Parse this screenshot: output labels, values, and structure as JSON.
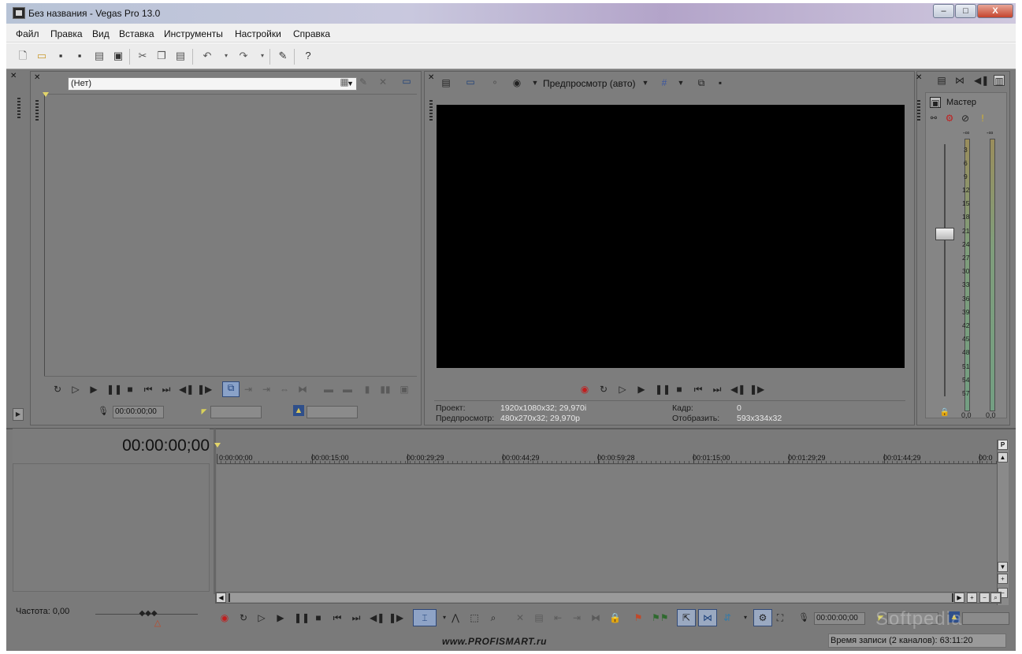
{
  "window": {
    "title": "Без названия - Vegas Pro 13.0",
    "minimize": "–",
    "maximize": "□",
    "close": "X"
  },
  "menu": [
    "Файл",
    "Правка",
    "Вид",
    "Вставка",
    "Инструменты",
    "Настройки",
    "Справка"
  ],
  "toolbar": {
    "icons": [
      "new-file-icon",
      "open-folder-icon",
      "save-icon",
      "save-as-icon",
      "render-icon",
      "properties-icon",
      "cut-icon",
      "copy-icon",
      "paste-icon",
      "undo-icon",
      "redo-icon",
      "edit-tool-icon",
      "help-icon"
    ]
  },
  "explorer": {
    "combo_value": "(Нет)"
  },
  "explorer_transport": {
    "timecode": "00:00:00;00"
  },
  "preview": {
    "mode_label": "Предпросмотр (авто)",
    "project_label": "Проект:",
    "project_value": "1920x1080x32; 29,970i",
    "preview_label": "Предпросмотр:",
    "preview_value": "480x270x32; 29,970p",
    "frame_label": "Кадр:",
    "frame_value": "0",
    "display_label": "Отобразить:",
    "display_value": "593x334x32"
  },
  "mixer": {
    "master_label": "Мастер",
    "meter_top": [
      "-∞",
      "-∞"
    ],
    "scale": [
      "3",
      "6",
      "9",
      "12",
      "15",
      "18",
      "21",
      "24",
      "27",
      "30",
      "33",
      "36",
      "39",
      "42",
      "45",
      "48",
      "51",
      "54",
      "57"
    ],
    "left_value": "0,0",
    "right_value": "0,0"
  },
  "timeline": {
    "cursor_timecode": "00:00:00;00",
    "ruler": [
      "0:00:00;00",
      "00:00:15;00",
      "00:00:29;29",
      "00:00:44;29",
      "00:00:59;28",
      "00:01:15;00",
      "00:01:29;29",
      "00:01:44;29",
      "00:0"
    ],
    "rate_label": "Частота: 0,00",
    "transport_timecode": "00:00:00;00",
    "record_time": "Время записи (2 каналов): 63:11:20"
  },
  "watermarks": {
    "site": "www.PROFISMART.ru",
    "softpedia": "Softpedia"
  },
  "colors": {
    "workspace": "#7a7a7a",
    "video": "#000000",
    "titlebar": "#c9c8de"
  }
}
